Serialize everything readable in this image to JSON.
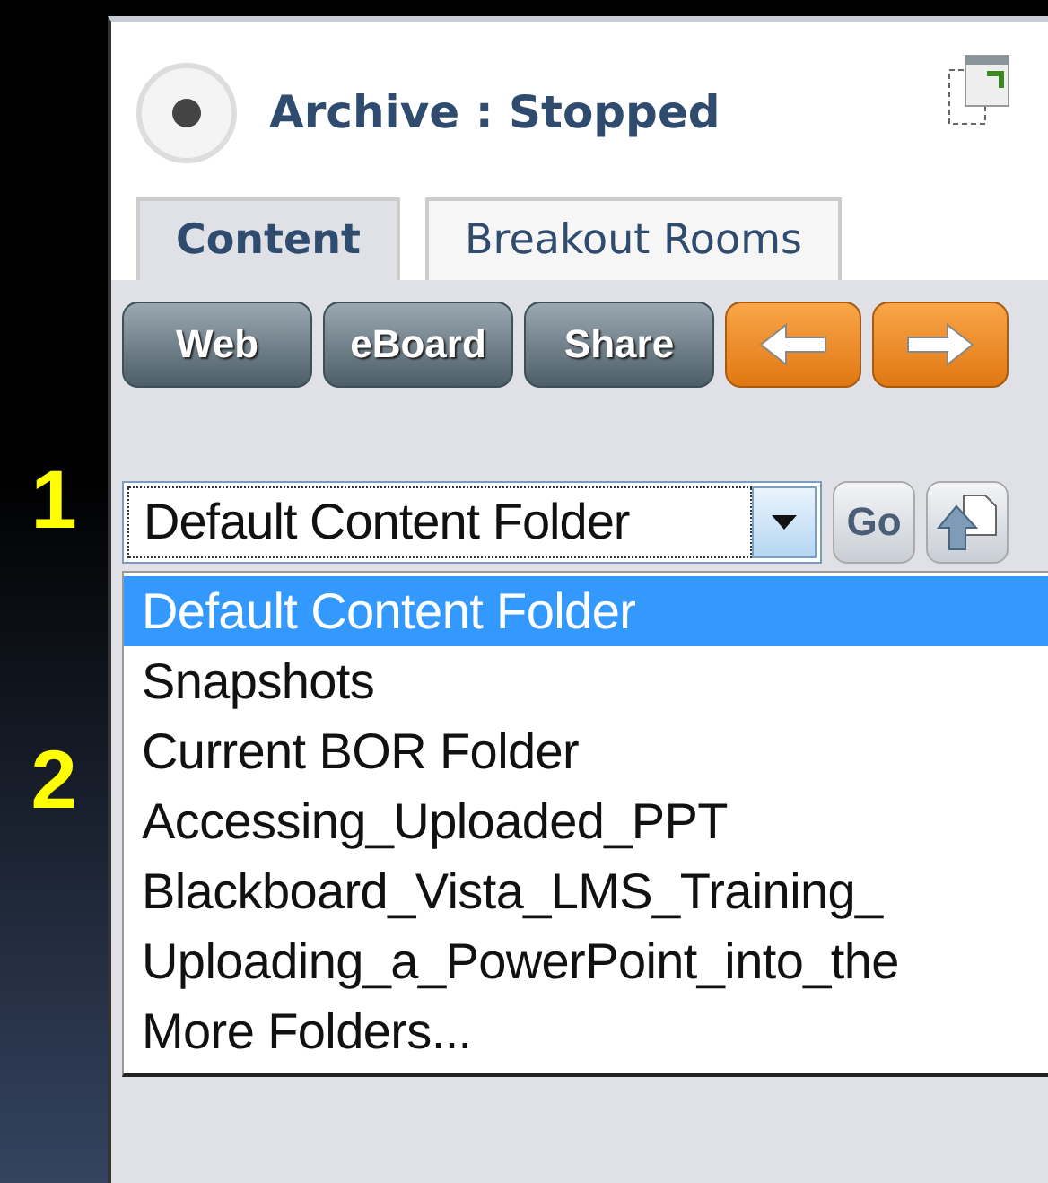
{
  "markers": [
    "1",
    "2"
  ],
  "header": {
    "title": "Archive : Stopped"
  },
  "tabs": [
    {
      "label": "Content",
      "selected": true
    },
    {
      "label": "Breakout Rooms",
      "selected": false
    }
  ],
  "toolbar": [
    {
      "kind": "text",
      "label": "Web"
    },
    {
      "kind": "text",
      "label": "eBoard"
    },
    {
      "kind": "text",
      "label": "Share"
    },
    {
      "kind": "arrow-left"
    },
    {
      "kind": "arrow-right"
    }
  ],
  "folder_select": {
    "value": "Default Content Folder",
    "expanded": true
  },
  "go_button": "Go",
  "dropdown": [
    {
      "label": "Default Content Folder",
      "selected": true
    },
    {
      "label": "Snapshots",
      "selected": false
    },
    {
      "label": "Current BOR Folder",
      "selected": false
    },
    {
      "label": "Accessing_Uploaded_PPT",
      "selected": false
    },
    {
      "label": "Blackboard_Vista_LMS_Training_",
      "selected": false
    },
    {
      "label": "Uploading_a_PowerPoint_into_the",
      "selected": false
    },
    {
      "label": "More Folders...",
      "selected": false
    }
  ]
}
